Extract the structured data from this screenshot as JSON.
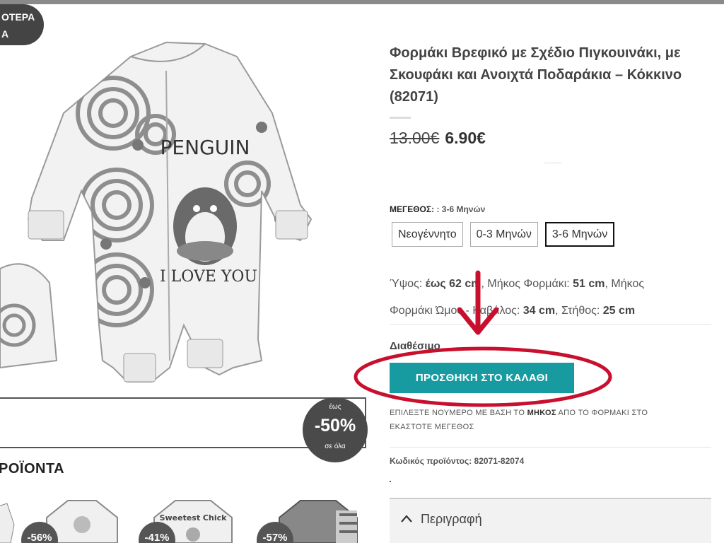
{
  "product": {
    "title": "Φορμάκι Βρεφικό με Σχέδιο Πιγκουινάκι, με Σκουφάκι και Ανοιχτά Ποδαράκια – Κόκκινο (82071)",
    "old_price": "13.00€",
    "price": "6.90€",
    "image_text_top": "PENGUIN",
    "image_text_bottom": "I LOVE YOU"
  },
  "size": {
    "label": "ΜΕΓΕΘΟΣ:",
    "selected_value": ": 3-6 Μηνών",
    "options": [
      "Νεογέννητο",
      "0-3 Μηνών",
      "3-6 Μηνών"
    ],
    "selected_index": 2
  },
  "dimensions": {
    "height_label": "Ύψος:",
    "height_value": "έως 62 cm",
    "length_label": "Μήκος Φορμάκι:",
    "length_value": "51 cm",
    "length_trail": "Μήκος",
    "shoulder_label": "Φορμάκι Ώμος - Καβάλος:",
    "shoulder_value": "34 cm",
    "chest_label": "Στήθος:",
    "chest_value": "25 cm"
  },
  "availability": "Διαθέσιμο",
  "add_to_cart_label": "ΠΡΟΣΘΗΚΗ ΣΤΟ ΚΑΛΑΘΙ",
  "note": {
    "part1": "ΕΠΙΛΕΞΤΕ ΝΟΥΜΕΡΟ ΜΕ ΒΑΣΗ ΤΟ",
    "bold": "ΜΗΚΟΣ",
    "part2": "ΑΠΟ ΤΟ ΦΟΡΜΑΚΙ ΣΤΟ ΕΚΑΣΤΟΤΕ ΜΕΓΕΘΟΣ"
  },
  "sku": "Κωδικός προϊόντος: 82071-82074",
  "tabs": {
    "description": "Περιγραφή"
  },
  "promo": {
    "pill_line1": "ΟΤΕΡΑ",
    "pill_line2": "Α",
    "circle_top": "έως",
    "circle_big": "-50%",
    "circle_bottom": "σε όλα"
  },
  "related": {
    "heading": "ΡΟΪΟΝΤΑ",
    "badges": [
      "-56%",
      "-41%",
      "-57%"
    ],
    "item_text": "Sweetest Chick"
  },
  "colors": {
    "accent": "#179ba0",
    "annotation": "#c8102e"
  }
}
